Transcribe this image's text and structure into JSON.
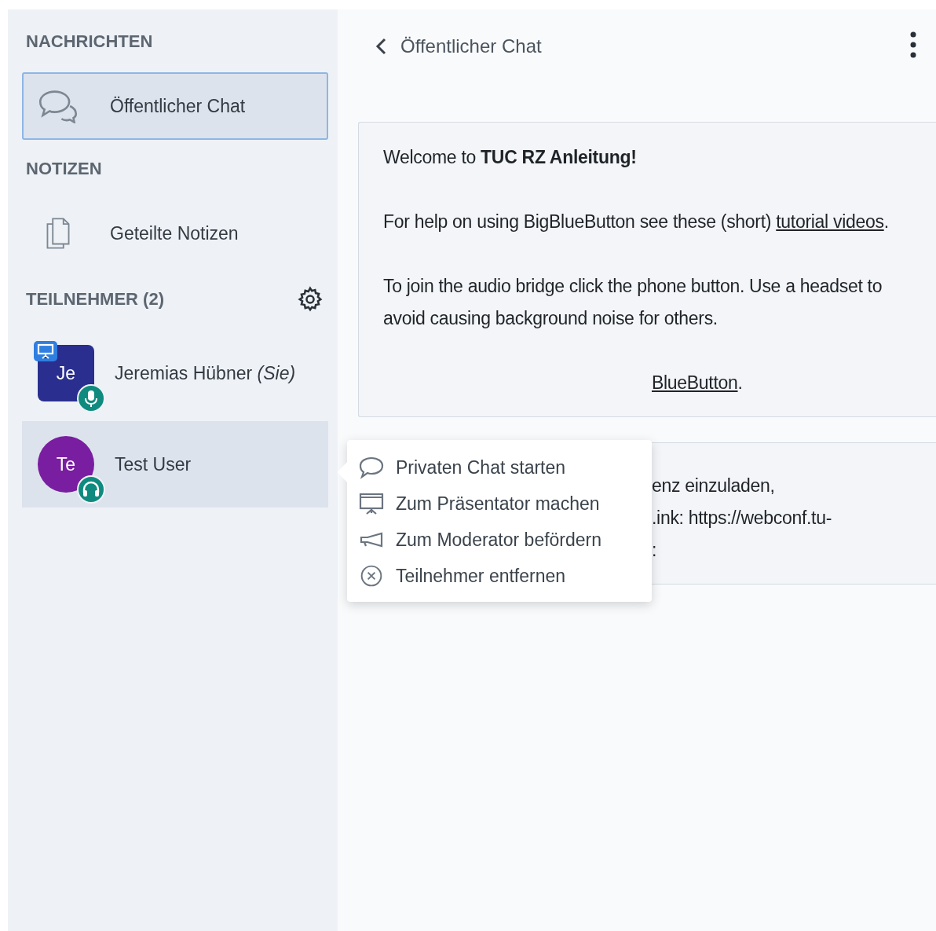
{
  "sidebar": {
    "sections": [
      {
        "title": "NACHRICHTEN",
        "kind": "links",
        "items": [
          {
            "label": "Öffentlicher Chat",
            "selected": true
          }
        ]
      },
      {
        "title": "NOTIZEN",
        "kind": "links",
        "items": [
          {
            "label": "Geteilte Notizen",
            "selected": false
          }
        ]
      },
      {
        "title": "TEILNEHMER (2)",
        "kind": "users",
        "users": [
          {
            "initials": "Je",
            "name": "Jeremias Hübner *(Sie)*",
            "moderator": true,
            "color": "#2a2f8f",
            "presenter": true,
            "listen_only": false,
            "selected": false
          },
          {
            "initials": "Te",
            "name": "Test User",
            "moderator": false,
            "color": "#7a1ea1",
            "presenter": false,
            "listen_only": true,
            "selected": true
          }
        ]
      }
    ]
  },
  "chat": {
    "title": "Öffentlicher Chat",
    "messages": [
      {
        "paragraphs": [
          [
            {
              "kind": "plain",
              "text": "Welcome to "
            },
            {
              "kind": "bold",
              "text": "TUC RZ Anleitung!"
            }
          ],
          [
            {
              "kind": "plain",
              "text": "For help on using BigBlueButton see these (short) "
            },
            {
              "kind": "link",
              "text": "tutorial videos"
            },
            {
              "kind": "plain",
              "text": "."
            }
          ],
          [
            {
              "kind": "plain",
              "text": "To join the audio bridge click the phone button. Use a headset to avoid causing background noise for others."
            }
          ]
        ],
        "covered_lines": [
          [
            {
              "kind": "link",
              "text": "BlueButton"
            },
            {
              "kind": "plain",
              "text": "."
            }
          ]
        ]
      },
      {
        "covered_lines": [
          [
            {
              "kind": "plain",
              "text": "enz einzuladen,"
            }
          ],
          [
            {
              "kind": "plain",
              "text": ".ink: https://webconf.tu-"
            }
          ],
          [
            {
              "kind": "plain",
              "text": ":"
            }
          ]
        ]
      }
    ]
  },
  "context_menu": {
    "items": [
      {
        "label": "Privaten Chat starten"
      },
      {
        "label": "Zum Präsentator machen"
      },
      {
        "label": "Zum Moderator befördern"
      },
      {
        "label": "Teilnehmer entfernen"
      }
    ]
  }
}
